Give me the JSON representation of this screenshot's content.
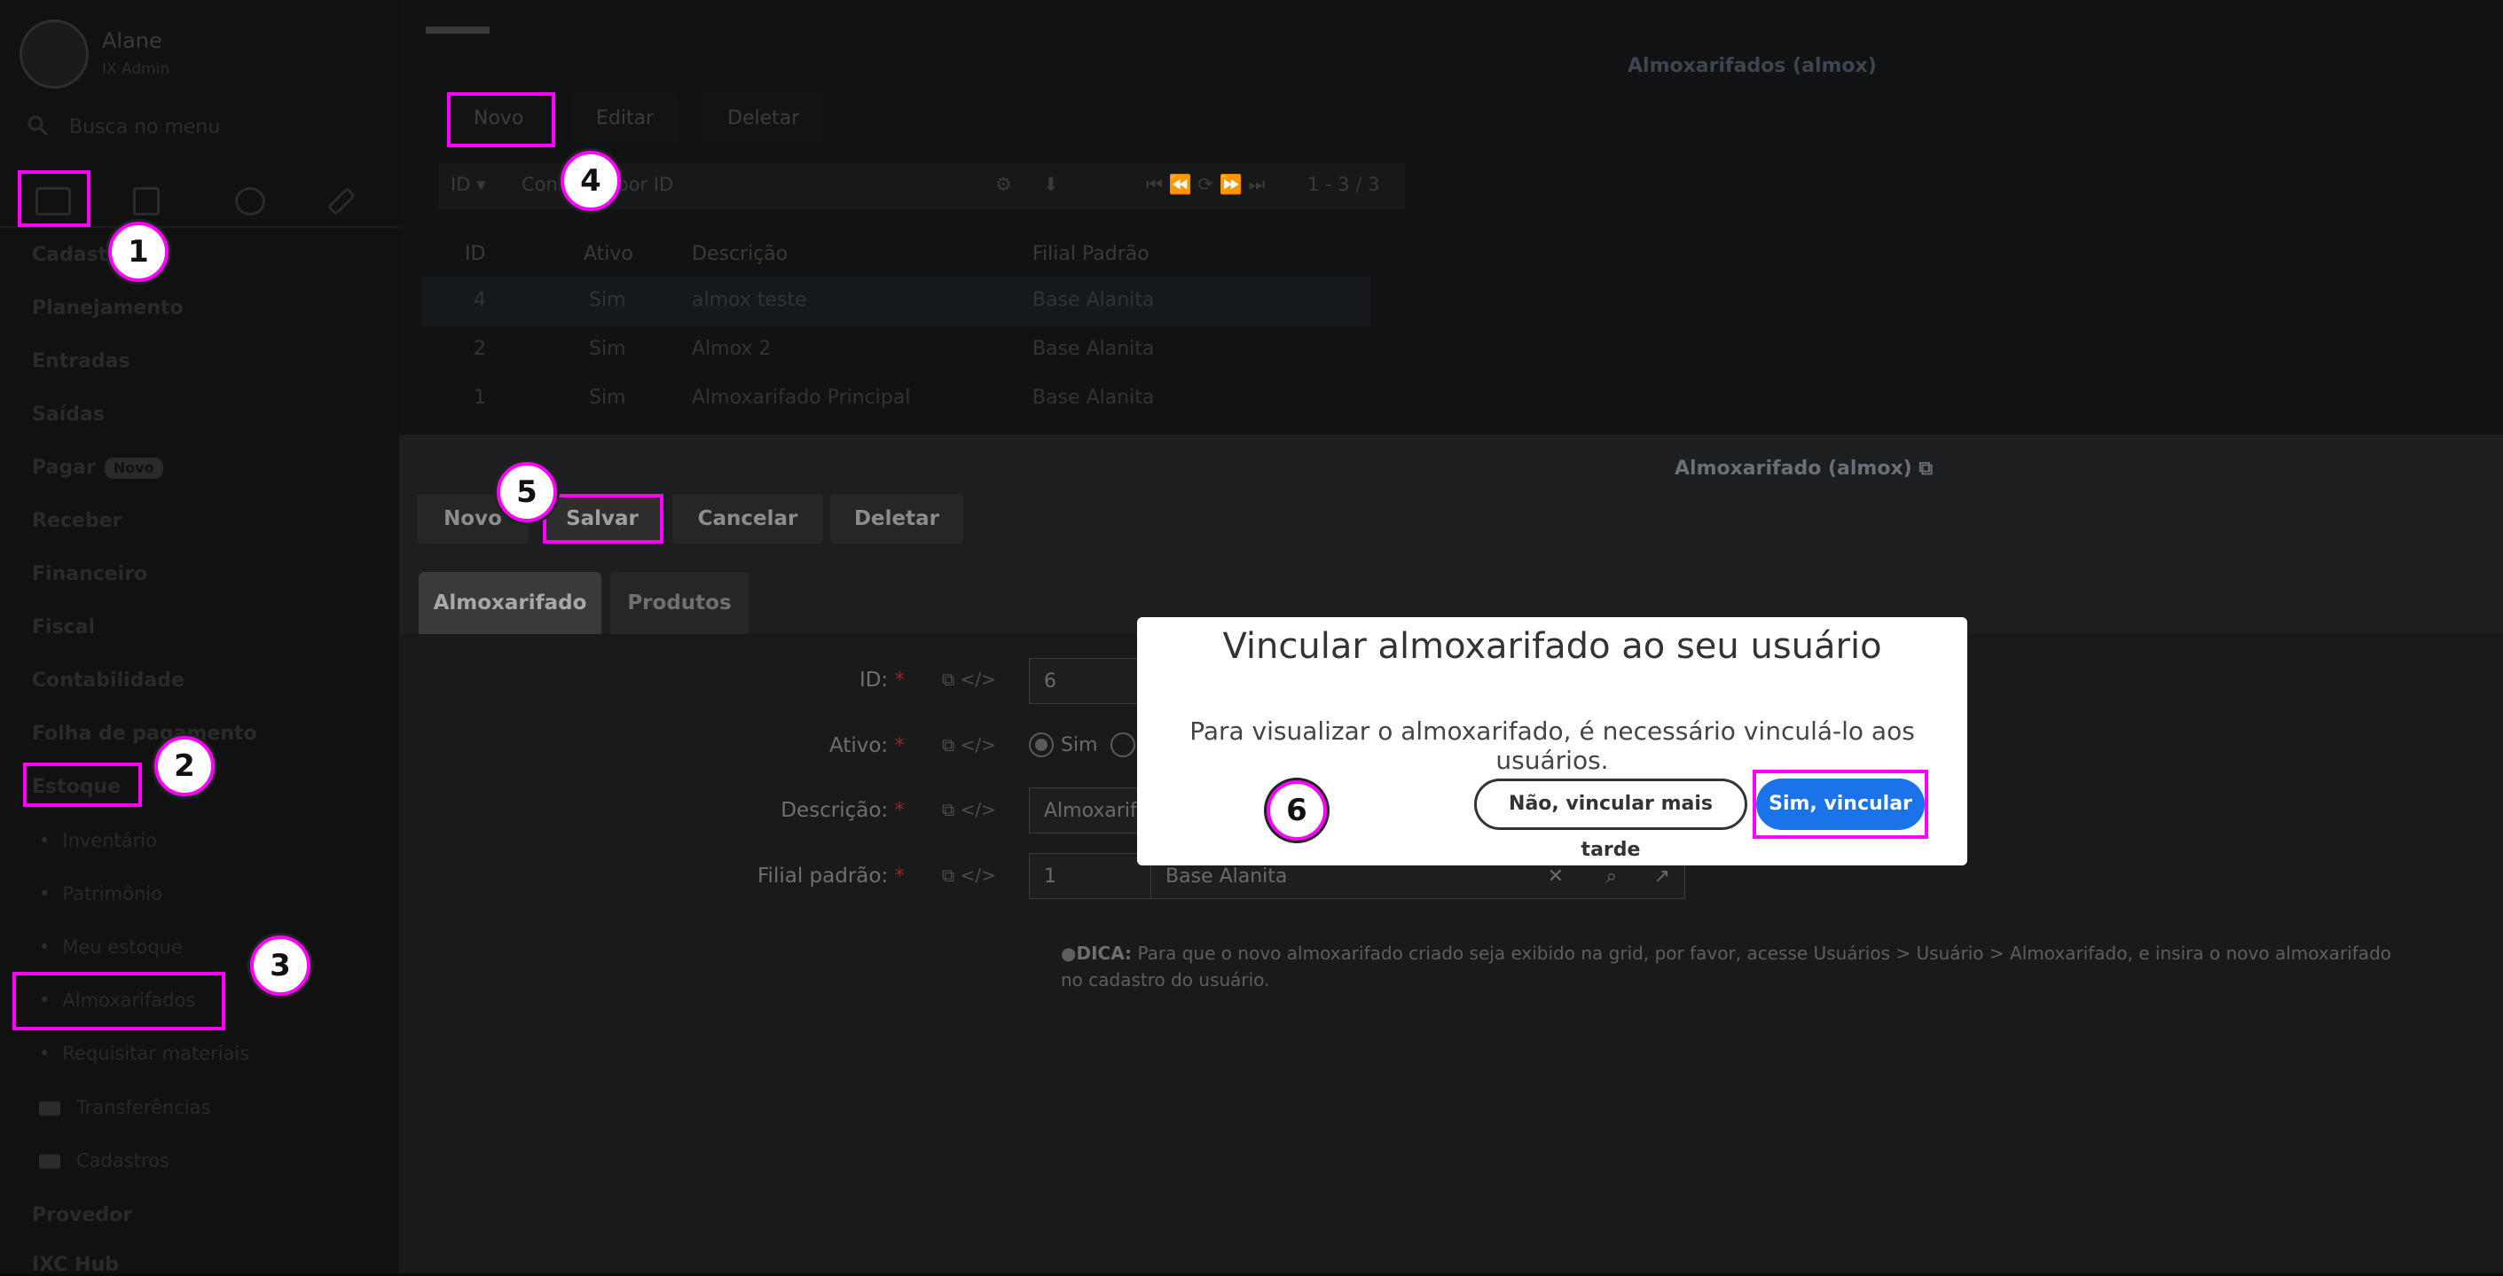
{
  "sidebar": {
    "user_name": "Alane",
    "user_sub": "IX Admin",
    "search_placeholder": "Busca no menu",
    "menu": {
      "cadastros": "Cadastros",
      "planejamento": "Planejamento",
      "entradas": "Entradas",
      "saidas": "Saídas",
      "pagar": "Pagar",
      "pagar_badge": "Novo",
      "receber": "Receber",
      "financeiro": "Financeiro",
      "fiscal": "Fiscal",
      "contabilidade": "Contabilidade",
      "folha": "Folha de pagamento",
      "estoque": "Estoque"
    },
    "estoque_items": {
      "inventario": "Inventário",
      "patrimonio": "Patrimônio",
      "meu_estoque": "Meu estoque",
      "almoxarifados": "Almoxarifados",
      "requisitar": "Requisitar materiais",
      "transferencias": "Transferências",
      "cadastros": "Cadastros"
    },
    "provedor": "Provedor",
    "ixc_hub": "IXC Hub"
  },
  "grid": {
    "title": "Almoxarifados (almox)",
    "toolbar": {
      "novo": "Novo",
      "editar": "Editar",
      "deletar": "Deletar"
    },
    "filter_field": "ID ▾",
    "filter_placeholder": "Consultar por ID",
    "pagination": "1 - 3 / 3",
    "columns": {
      "id": "ID",
      "ativo": "Ativo",
      "descricao": "Descrição",
      "filial": "Filial Padrão"
    },
    "rows": [
      {
        "id": "4",
        "ativo": "Sim",
        "descricao": "almox teste",
        "filial": "Base Alanita"
      },
      {
        "id": "2",
        "ativo": "Sim",
        "descricao": "Almox 2",
        "filial": "Base Alanita"
      },
      {
        "id": "1",
        "ativo": "Sim",
        "descricao": "Almoxarifado Principal",
        "filial": "Base Alanita"
      }
    ]
  },
  "form": {
    "title": "Almoxarifado (almox)",
    "buttons": {
      "novo": "Novo",
      "salvar": "Salvar",
      "cancelar": "Cancelar",
      "deletar": "Deletar"
    },
    "tabs": {
      "almoxarifado": "Almoxarifado",
      "produtos": "Produtos"
    },
    "fields": {
      "id_label": "ID:",
      "id_value": "6",
      "ativo_label": "Ativo:",
      "ativo_sim": "Sim",
      "descricao_label": "Descrição:",
      "descricao_value": "Almoxarifa",
      "filial_label": "Filial padrão:",
      "filial_id": "1",
      "filial_name": "Base Alanita",
      "required_mark": "*"
    },
    "tip_label": "DICA:",
    "tip_text": "Para que o novo almoxarifado criado seja exibido na grid, por favor, acesse Usuários > Usuário > Almoxarifado, e insira o novo almoxarifado no cadastro do usuário."
  },
  "modal": {
    "title": "Vincular almoxarifado ao seu usuário",
    "body": "Para visualizar o almoxarifado, é necessário vinculá-lo aos usuários.",
    "btn_no": "Não, vincular mais tarde",
    "btn_yes": "Sim, vincular"
  },
  "steps": [
    "1",
    "2",
    "3",
    "4",
    "5",
    "6"
  ],
  "colors": {
    "highlight": "#ff00ff",
    "primary": "#1a73e8"
  }
}
